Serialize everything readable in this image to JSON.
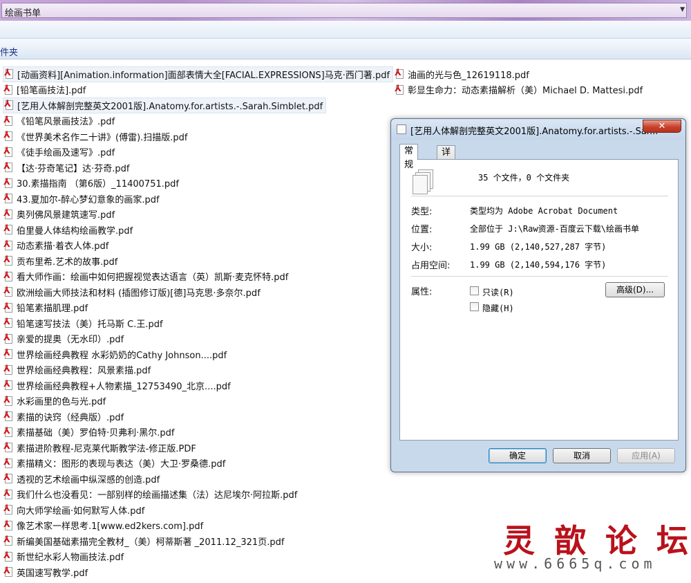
{
  "address_bar": {
    "path": "绘画书单"
  },
  "group_header": {
    "label": "文件夹"
  },
  "files_col1": [
    "[动画资料][Animation.information]面部表情大全[FACIAL.EXPRESSIONS]马克·西门著.pdf",
    "[铅笔画技法].pdf",
    "[艺用人体解剖完整英文2001版].Anatomy.for.artists.-.Sarah.Simblet.pdf",
    "《铅笔风景画技法》.pdf",
    "《世界美术名作二十讲》(傅雷).扫描版.pdf",
    "《徒手绘画及速写》.pdf",
    "【达·芬奇笔记】达·芬奇.pdf",
    "30.素描指南 （第6版）_11400751.pdf",
    "43.夏加尔-醉心梦幻意象的画家.pdf",
    "奥列佛风景建筑速写.pdf",
    "伯里曼人体结构绘画教学.pdf",
    "动态素描·着衣人体.pdf",
    "贡布里希.艺术的故事.pdf",
    "看大师作画：绘画中如何把握视觉表达语言（英）凯斯·麦克怀特.pdf",
    "欧洲绘画大师技法和材料 (插图修订版)[德]马克思·多奈尔.pdf",
    "铅笔素描肌理.pdf",
    "铅笔速写技法（美）托马斯 C.王.pdf",
    "亲爱的提奥（无水印）.pdf",
    "世界绘画经典教程 水彩奶奶的Cathy Johnson....pdf",
    "世界绘画经典教程：风景素描.pdf",
    "世界绘画经典教程+人物素描_12753490_北京....pdf",
    "水彩画里的色与光.pdf",
    "素描的诀窍（经典版）.pdf",
    "素描基础（美）罗伯特·贝弗利·黑尔.pdf",
    "素描进阶教程-尼克莱代斯教学法-修正版.PDF",
    "素描精义：图形的表现与表达（美）大卫·罗桑德.pdf",
    "透视的艺术绘画中纵深感的创造.pdf",
    "我们什么也没看见：一部别样的绘画描述集（法）达尼埃尔·阿拉斯.pdf",
    "向大师学绘画·如何默写人体.pdf",
    "像艺术家一样思考.1[www.ed2kers.com].pdf",
    "新编美国基础素描完全教材_（美）柯蒂斯著 _2011.12_321页.pdf",
    "新世纪水彩人物画技法.pdf",
    "英国速写教学.pdf"
  ],
  "files_col2": [
    "油画的光与色_12619118.pdf",
    "彰显生命力：动态素描解析（美）Michael D. Mattesi.pdf"
  ],
  "dialog": {
    "title": "[艺用人体解剖完整英文2001版].Anatomy.for.artists.-.Sar...",
    "close_label": "✕",
    "tabs": [
      "常规",
      "详细信息"
    ],
    "summary": "35 个文件，0 个文件夹",
    "type_label": "类型:",
    "type_value": "类型均为 Adobe Acrobat Document",
    "location_label": "位置:",
    "location_value": "全部位于 J:\\Raw资源-百度云下载\\绘画书单",
    "size_label": "大小:",
    "size_value": "1.99 GB (2,140,527,287 字节)",
    "disk_label": "占用空间:",
    "disk_value": "1.99 GB (2,140,594,176 字节)",
    "attr_label": "属性:",
    "readonly_label": "只读(R)",
    "hidden_label": "隐藏(H)",
    "advanced_button": "高级(D)...",
    "ok_button": "确定",
    "cancel_button": "取消",
    "apply_button": "应用(A)"
  },
  "watermark": {
    "title": "灵歆论坛",
    "url": "www.6665q.com"
  }
}
